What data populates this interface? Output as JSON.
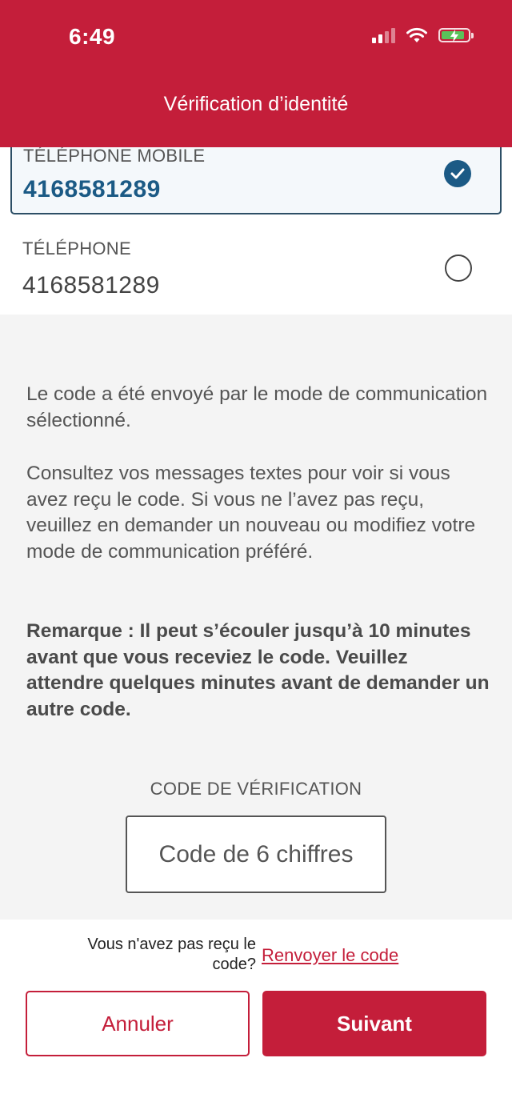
{
  "status_bar": {
    "time": "6:49",
    "battery_color": "#5ac35a"
  },
  "header": {
    "title": "Vérification d’identité",
    "background": "#c41e3a"
  },
  "contact_options": [
    {
      "label": "TÉLÉPHONE MOBILE",
      "value": "4168581289",
      "selected": true
    },
    {
      "label": "TÉLÉPHONE",
      "value": "4168581289",
      "selected": false
    }
  ],
  "info": {
    "paragraph1": "Le code a été envoyé par le mode de communication sélectionné.",
    "paragraph2": "Consultez vos messages textes pour voir si vous avez reçu le code. Si vous ne l’avez pas reçu, veuillez en demander un nouveau ou modifiez votre mode de communication préféré.",
    "note": "Remarque : Il peut s’écouler jusqu’à 10 minutes avant que vous receviez le code. Veuillez attendre quelques minutes avant de demander un autre code."
  },
  "verification": {
    "label": "CODE DE VÉRIFICATION",
    "value": "",
    "placeholder": "Code de 6 chiffres"
  },
  "resend": {
    "prompt": "Vous n'avez pas reçu le code?",
    "link": "Renvoyer le code"
  },
  "buttons": {
    "cancel": "Annuler",
    "next": "Suivant"
  },
  "colors": {
    "brand": "#c41e3a",
    "selected_accent": "#1b5a85",
    "panel": "#f4f4f4"
  },
  "icons": [
    "signal-icon",
    "wifi-icon",
    "battery-charging-icon",
    "check-icon",
    "radio-empty-icon"
  ]
}
